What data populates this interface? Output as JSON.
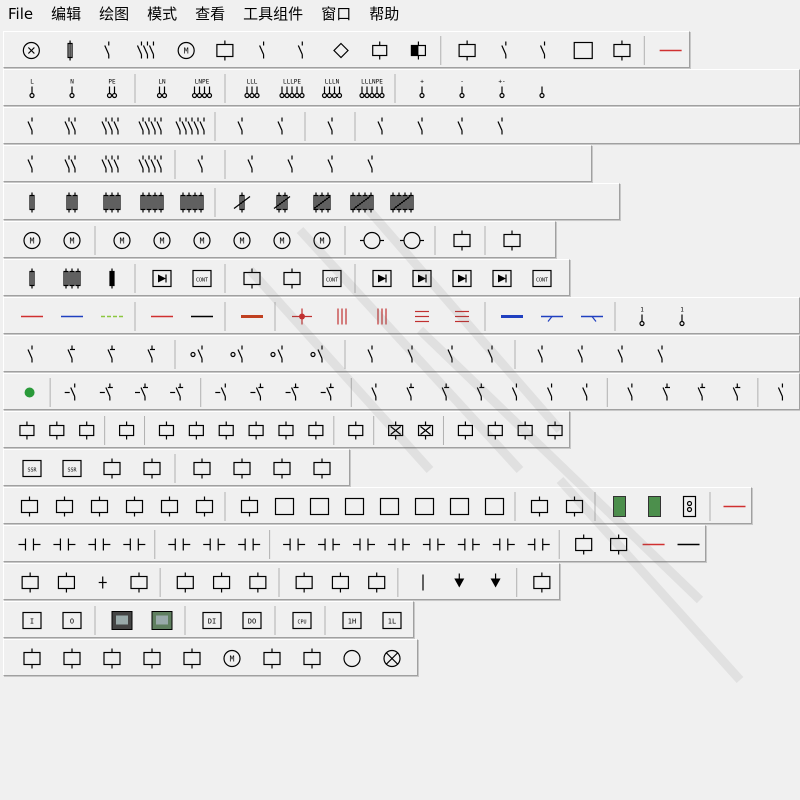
{
  "menu": [
    "File",
    "编辑",
    "绘图",
    "模式",
    "查看",
    "工具组件",
    "窗口",
    "帮助"
  ],
  "toolbar_icons": [
    [
      "lamp",
      "fuse",
      "switch-no",
      "switch-3p",
      "motor-dm",
      "box",
      "switch-single",
      "switch-emerg",
      "diamond",
      "relay-coil",
      "relay-coil-filled",
      "sep",
      "relay-box",
      "contactor",
      "contactor-2",
      "io-box",
      "connector",
      "sep",
      "red-line"
    ],
    [
      "term-L",
      "term-N",
      "term-PE",
      "sep",
      "term-LN",
      "term-LNPE",
      "sep",
      "term-LLL",
      "term-LLLPE",
      "term-LLLN",
      "term-LLLNPE",
      "sep",
      "term-plus",
      "term-minus",
      "term-plusminus",
      "term-extra"
    ],
    [
      "breaker-1p",
      "breaker-2p",
      "breaker-3p",
      "breaker-4p",
      "breaker-5p",
      "sep",
      "breaker-aux-1",
      "breaker-aux-2",
      "sep",
      "breaker-block",
      "sep",
      "breaker-box-1",
      "breaker-box-2",
      "breaker-box-3",
      "breaker-box-4"
    ],
    [
      "disconnect-1p",
      "disconnect-2p",
      "disconnect-3p",
      "disconnect-4p",
      "sep",
      "disconnect-fuse",
      "sep",
      "disconnect-load-1",
      "disconnect-load-2",
      "disconnect-load-3",
      "disconnect-load-4"
    ],
    [
      "fuse-1",
      "fuse-2",
      "fuse-3",
      "fuse-4",
      "fuse-5",
      "sep",
      "fuse-switch-1",
      "fuse-switch-2",
      "fuse-switch-3",
      "fuse-switch-4",
      "fuse-switch-5"
    ],
    [
      "motor-1",
      "motor-2",
      "sep",
      "motor-3",
      "motor-4",
      "motor-5",
      "motor-6",
      "motor-7",
      "motor-8",
      "sep",
      "fan-1",
      "fan-2",
      "sep",
      "pump",
      "sep",
      "valve"
    ],
    [
      "resistor",
      "resistor-3",
      "resistor-black",
      "sep",
      "diode-bridge",
      "controller",
      "sep",
      "converter-1",
      "converter-2",
      "cont-ac",
      "sep",
      "diode-box-1",
      "diode-box-2",
      "diode-box-3",
      "diode-box-4",
      "cont-box"
    ],
    [
      "wire-red",
      "wire-blue",
      "wire-green",
      "sep",
      "wire-red-2",
      "wire-black",
      "sep",
      "wire-yellow",
      "sep",
      "node-red",
      "bus-red-1",
      "bus-red-2",
      "bus-red-3",
      "bus-red-4",
      "sep",
      "wire-blue-thick",
      "wire-blue-tap",
      "wire-blue-tap-2",
      "sep",
      "term-1",
      "term-1-pin"
    ],
    [
      "contact-no",
      "contact-nc",
      "contact-no-nc",
      "contact-nc-2",
      "sep",
      "contact-time-1",
      "contact-time-2",
      "contact-time-3",
      "contact-time-4",
      "sep",
      "contact-pos-1",
      "contact-pos-2",
      "contact-pos-3",
      "contact-pos-4",
      "sep",
      "contact-temp-1",
      "contact-temp-2",
      "contact-temp-3",
      "contact-temp-4"
    ],
    [
      "node-green",
      "sep",
      "push-no",
      "push-nc",
      "push-no-nc",
      "push-nc-2",
      "sep",
      "pull-no",
      "pull-nc",
      "pull-no-nc",
      "pull-nc-2",
      "sep",
      "lim-no",
      "lim-nc",
      "lim-no-nc",
      "lim-nc-2",
      "lim-ext-1",
      "lim-ext-2",
      "lim-ext-3",
      "sep",
      "press-no",
      "press-nc",
      "press-no-nc",
      "press-nc-2",
      "sep",
      "foot-switch"
    ],
    [
      "coil-1",
      "coil-2",
      "coil-3",
      "sep",
      "coil-solenoid",
      "sep",
      "coil-on-delay",
      "coil-off-delay",
      "coil-impulse",
      "coil-latch",
      "coil-reset",
      "coil-time",
      "sep",
      "coil-plain",
      "sep",
      "indicator-1",
      "indicator-2",
      "sep",
      "horn-1",
      "horn-2",
      "horn-3",
      "horn-4"
    ],
    [
      "ssr-1",
      "ssr-2",
      "heater-1",
      "heater-2",
      "sep",
      "thyristor-1",
      "thyristor-2",
      "thyristor-3",
      "thyristor-4"
    ],
    [
      "timer-1",
      "timer-2",
      "proximity",
      "counter",
      "timer-3",
      "timer-4",
      "sep",
      "flipflop-sr",
      "plc-func-1",
      "plc-func-2",
      "plc-func-3",
      "plc-func-4",
      "plc-func-5",
      "plc-func-6",
      "plc-func-7",
      "sep",
      "compare",
      "pulse",
      "sep",
      "module-green-1",
      "module-green-2",
      "module-bat",
      "sep",
      "red-line-2"
    ],
    [
      "ladder-no",
      "ladder-nc",
      "ladder-p",
      "ladder-n",
      "sep",
      "ladder-coil",
      "ladder-set",
      "ladder-reset",
      "sep",
      "ladder-sr",
      "ladder-f1",
      "ladder-f2",
      "ladder-f3",
      "ladder-f4",
      "ladder-f5",
      "ladder-f6",
      "ladder-f7",
      "sep",
      "pin-1",
      "pin-2",
      "line-red",
      "line-black"
    ],
    [
      "sensor-square",
      "box-empty",
      "junction-plus",
      "rect-empty",
      "sep",
      "tee-1",
      "net-1",
      "net-2",
      "sep",
      "split-1",
      "tree-1",
      "tree-2",
      "sep",
      "bar-vertical",
      "tri-down-1",
      "tri-down-2",
      "sep",
      "marker-box"
    ],
    [
      "io-I",
      "io-O",
      "sep",
      "hmi-1",
      "hmi-3d",
      "sep",
      "plc-DI",
      "plc-DO",
      "sep",
      "plc-CPU",
      "sep",
      "plc-1H",
      "plc-1L"
    ],
    [
      "servo-1",
      "drive-1",
      "drive-2",
      "cabinet",
      "bell",
      "motor-conn",
      "pump-2",
      "valve-2",
      "lamp-circle",
      "lamp-cross"
    ]
  ]
}
